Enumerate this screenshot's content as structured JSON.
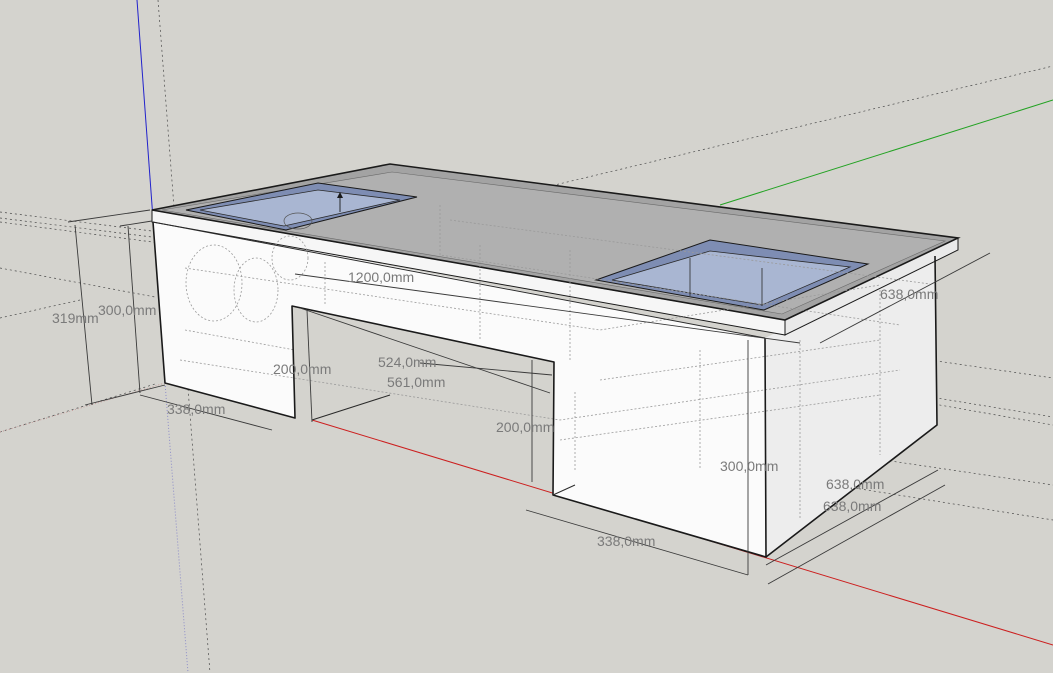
{
  "colors": {
    "background": "#d4d3ce",
    "face_light": "#f4f4f4",
    "face_white": "#fbfbfb",
    "top_face": "#a3a3a3",
    "hole_blue": "#a9b6d2",
    "axis_red": "#cc1f1f",
    "axis_green": "#22a222",
    "axis_blue": "#2222cc"
  },
  "dimensions": {
    "length_total": "1200,0mm",
    "height_left": "300,0mm",
    "height_overall": "319mm",
    "height_right": "300,0mm",
    "depth_top": "638,0mm",
    "depth_bottom_1": "638,0mm",
    "depth_bottom_2": "638,0mm",
    "leg_left_width": "338,0mm",
    "leg_right_width": "338,0mm",
    "opening_height_left": "200,0mm",
    "opening_height_right": "200,0mm",
    "opening_width_inner": "524,0mm",
    "opening_width_outer": "561,0mm"
  }
}
